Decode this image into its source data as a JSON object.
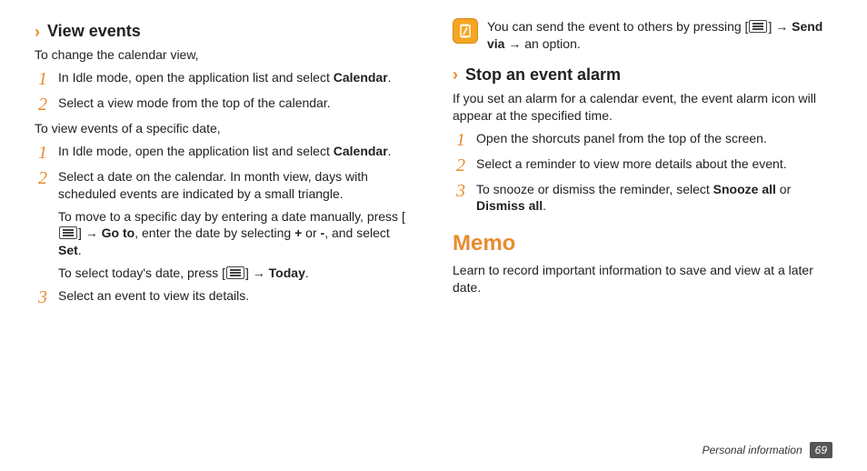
{
  "left": {
    "heading1": "View events",
    "intro1": "To change the calendar view,",
    "list1": {
      "item1": {
        "num": "1",
        "pre": "In Idle mode, open the application list and select ",
        "bold": "Calendar",
        "post": "."
      },
      "item2": {
        "num": "2",
        "text": "Select a view mode from the top of the calendar."
      }
    },
    "intro2": "To view events of a specific date,",
    "list2": {
      "item1": {
        "num": "1",
        "pre": "In Idle mode, open the application list and select ",
        "bold": "Calendar",
        "post": "."
      },
      "item2": {
        "num": "2",
        "text": "Select a date on the calendar. In month view, days with scheduled events are indicated by a small triangle.",
        "sub1": {
          "p1": "To move to a specific day by entering a date manually, press [",
          "p2": "] → ",
          "b1": "Go to",
          "p3": ", enter the date by selecting ",
          "b2": "+",
          "p4": " or ",
          "b3": "-",
          "p5": ", and select ",
          "b4": "Set",
          "p6": "."
        },
        "sub2": {
          "p1": "To select today's date, press [",
          "p2": "] → ",
          "b1": "Today",
          "p3": "."
        }
      },
      "item3": {
        "num": "3",
        "text": "Select an event to view its details."
      }
    }
  },
  "right": {
    "tip": {
      "p1": "You can send the event to others by pressing [",
      "p2": "] → ",
      "b1": "Send via",
      "p3": " → an option."
    },
    "heading2": "Stop an event alarm",
    "intro3": "If you set an alarm for a calendar event, the event alarm icon will appear at the specified time.",
    "list3": {
      "item1": {
        "num": "1",
        "text": "Open the shorcuts panel from the top of the screen."
      },
      "item2": {
        "num": "2",
        "text": "Select a reminder to view more details about the event."
      },
      "item3": {
        "num": "3",
        "pre": "To snooze or dismiss the reminder, select ",
        "b1": "Snooze all",
        "mid": " or ",
        "b2": "Dismiss all",
        "post": "."
      }
    },
    "memo_heading": "Memo",
    "memo_text": "Learn to record important information to save and view at a later date."
  },
  "footer": {
    "section": "Personal information",
    "page": "69"
  }
}
